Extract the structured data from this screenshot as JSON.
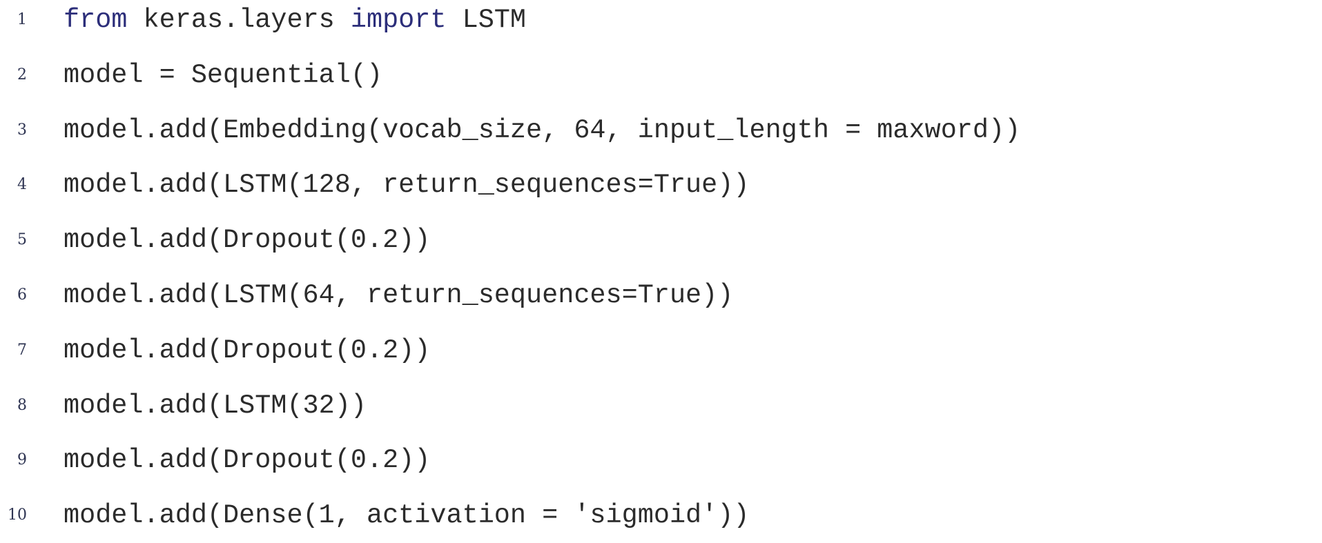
{
  "code_listing": {
    "lines": [
      {
        "number": "1",
        "tokens": [
          {
            "text": "from",
            "keyword": true
          },
          {
            "text": " keras.layers ",
            "keyword": false
          },
          {
            "text": "import",
            "keyword": true
          },
          {
            "text": " LSTM",
            "keyword": false
          }
        ]
      },
      {
        "number": "2",
        "tokens": [
          {
            "text": "model = Sequential()",
            "keyword": false
          }
        ]
      },
      {
        "number": "3",
        "tokens": [
          {
            "text": "model.add(Embedding(vocab_size, 64, input_length = maxword))",
            "keyword": false
          }
        ]
      },
      {
        "number": "4",
        "tokens": [
          {
            "text": "model.add(LSTM(128, return_sequences=True))",
            "keyword": false
          }
        ]
      },
      {
        "number": "5",
        "tokens": [
          {
            "text": "model.add(Dropout(0.2))",
            "keyword": false
          }
        ]
      },
      {
        "number": "6",
        "tokens": [
          {
            "text": "model.add(LSTM(64, return_sequences=True))",
            "keyword": false
          }
        ]
      },
      {
        "number": "7",
        "tokens": [
          {
            "text": "model.add(Dropout(0.2))",
            "keyword": false
          }
        ]
      },
      {
        "number": "8",
        "tokens": [
          {
            "text": "model.add(LSTM(32))",
            "keyword": false
          }
        ]
      },
      {
        "number": "9",
        "tokens": [
          {
            "text": "model.add(Dropout(0.2))",
            "keyword": false
          }
        ]
      },
      {
        "number": "10",
        "tokens": [
          {
            "text": "model.add(Dense(1, activation = 'sigmoid'))",
            "keyword": false
          }
        ]
      }
    ],
    "colors": {
      "text": "#2b2b2b",
      "keyword": "#2c2e7a",
      "line_number": "#2e3452",
      "background": "#ffffff"
    }
  }
}
